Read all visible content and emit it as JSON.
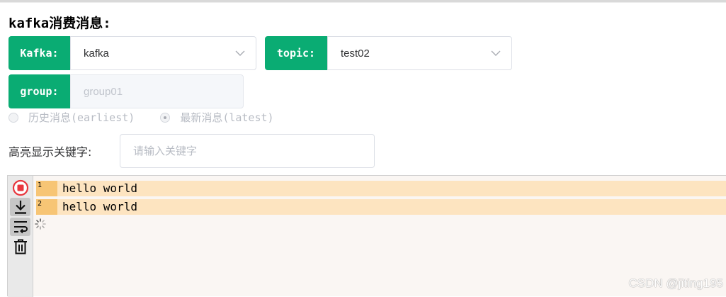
{
  "page": {
    "title": "kafka消费消息:"
  },
  "form": {
    "kafka": {
      "label": "Kafka:",
      "value": "kafka"
    },
    "topic": {
      "label": "topic:",
      "value": "test02"
    },
    "group": {
      "label": "group:",
      "placeholder": "group01"
    },
    "offset": {
      "options": [
        {
          "label": "历史消息(earliest)",
          "checked": false
        },
        {
          "label": "最新消息(latest)",
          "checked": true
        }
      ]
    },
    "keyword": {
      "label": "高亮显示关键字:",
      "placeholder": "请输入关键字",
      "value": ""
    }
  },
  "console": {
    "tools": [
      "stop-icon",
      "scroll-to-bottom-icon",
      "wrap-lines-icon",
      "clear-icon"
    ],
    "lines": [
      {
        "no": "1",
        "text": "hello world"
      },
      {
        "no": "2",
        "text": "hello world"
      }
    ]
  },
  "watermark": "CSDN @jiting195",
  "colors": {
    "accent": "#0aac73",
    "highlight": "#fde4c0",
    "line_number_bg": "#f7c575",
    "stop": "#e8373e"
  }
}
